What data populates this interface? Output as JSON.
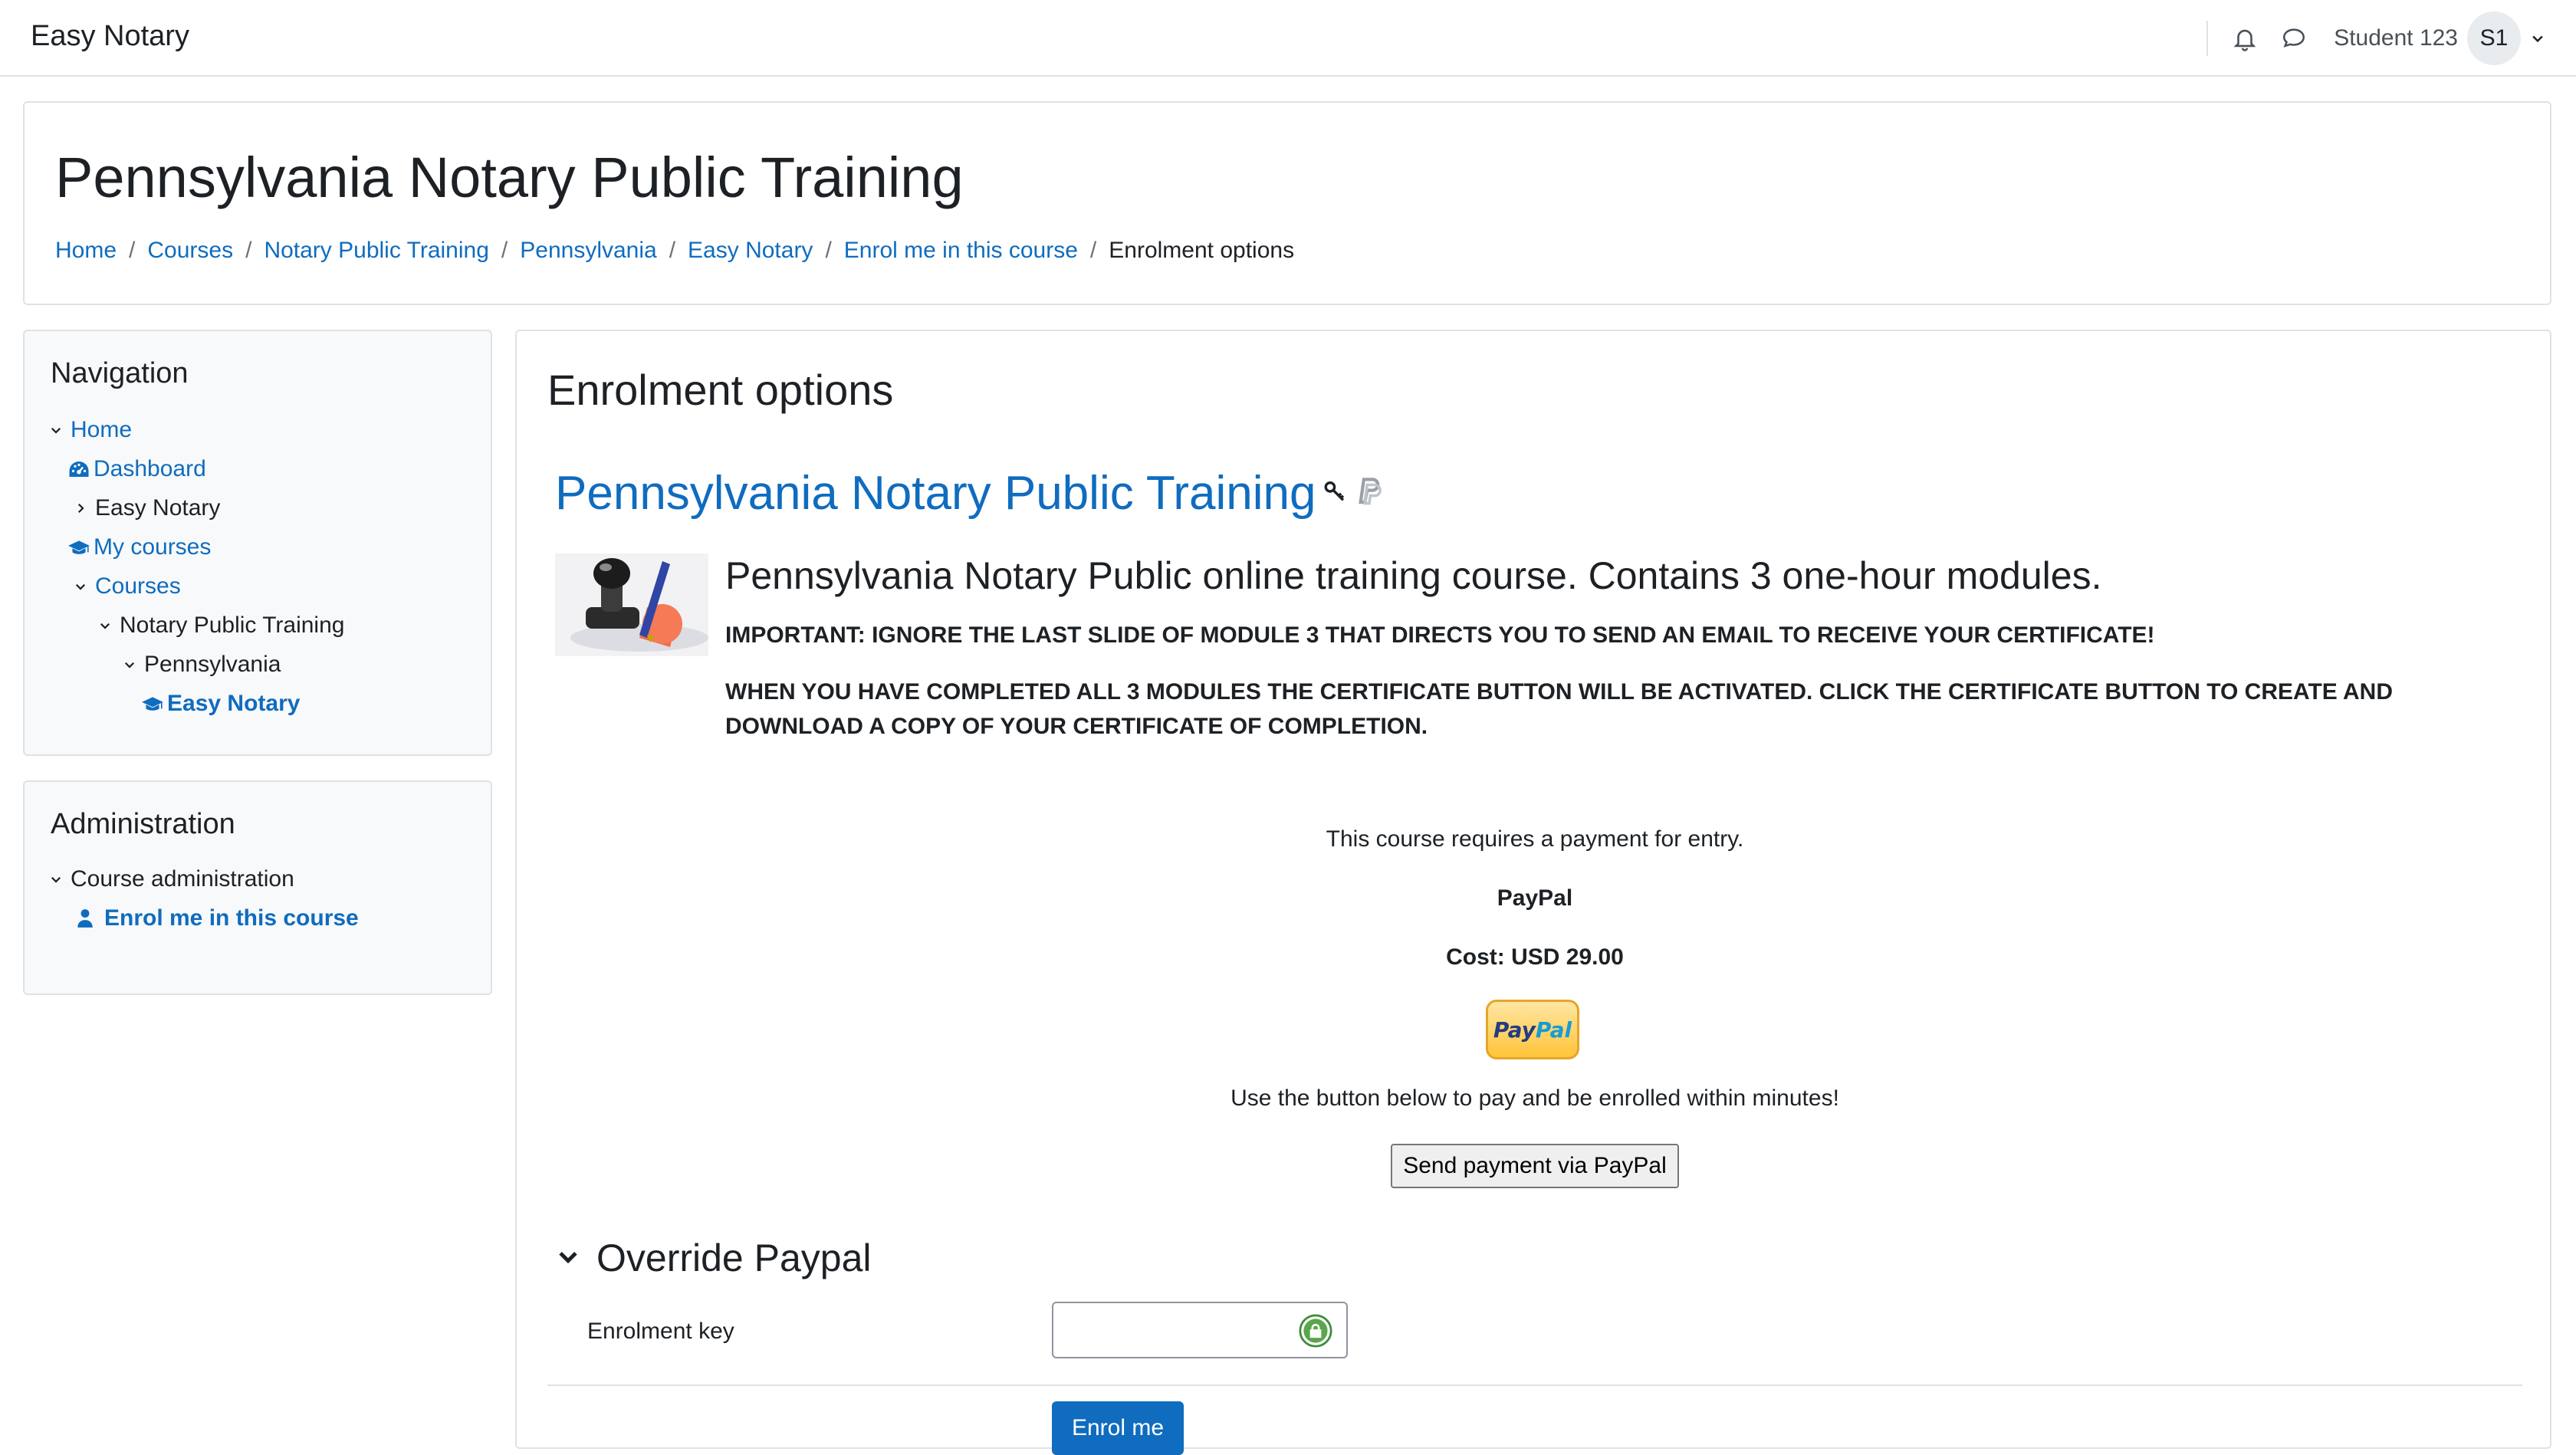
{
  "navbar": {
    "brand": "Easy Notary",
    "user_name": "Student 123",
    "user_initials": "S1",
    "icons": [
      "bell-icon",
      "chat-icon",
      "chevron-down-icon"
    ]
  },
  "header": {
    "title": "Pennsylvania Notary Public Training",
    "breadcrumb": [
      "Home",
      "Courses",
      "Notary Public Training",
      "Pennsylvania",
      "Easy Notary",
      "Enrol me in this course",
      "Enrolment options"
    ]
  },
  "navigation_block": {
    "title": "Navigation",
    "items": [
      {
        "label": "Home",
        "icon": "chevron-down-icon"
      },
      {
        "label": "Dashboard",
        "icon": "dashboard-icon"
      },
      {
        "label": "Easy Notary",
        "icon": "chevron-right-icon"
      },
      {
        "label": "My courses",
        "icon": "graduation-cap-icon"
      },
      {
        "label": "Courses",
        "icon": "chevron-down-icon"
      },
      {
        "label": "Notary Public Training",
        "icon": "chevron-down-icon"
      },
      {
        "label": "Pennsylvania",
        "icon": "chevron-down-icon"
      },
      {
        "label": "Easy Notary",
        "icon": "graduation-cap-icon"
      }
    ]
  },
  "admin_block": {
    "title": "Administration",
    "items": [
      {
        "label": "Course administration",
        "icon": "chevron-down-icon"
      },
      {
        "label": "Enrol me in this course",
        "icon": "user-icon"
      }
    ]
  },
  "main": {
    "heading": "Enrolment options",
    "course_name": "Pennsylvania Notary Public Training",
    "course_icons": [
      "key-icon",
      "paypal-icon"
    ],
    "summary_headline": "Pennsylvania Notary Public online training course. Contains 3 one-hour modules.",
    "summary_important": "IMPORTANT: IGNORE THE LAST SLIDE OF MODULE 3 THAT DIRECTS YOU TO SEND AN EMAIL TO RECEIVE YOUR CERTIFICATE!",
    "summary_certificate": "WHEN YOU HAVE COMPLETED ALL 3 MODULES THE CERTIFICATE BUTTON WILL BE ACTIVATED. CLICK THE CERTIFICATE BUTTON TO CREATE AND DOWNLOAD A COPY OF YOUR CERTIFICATE OF COMPLETION.",
    "payment": {
      "requires_text": "This course requires a payment for entry.",
      "method": "PayPal",
      "cost": "Cost: USD 29.00",
      "logo_text_1": "Pay",
      "logo_text_2": "Pal",
      "instruction": "Use the button below to pay and be enrolled within minutes!",
      "button_label": "Send payment via PayPal"
    },
    "override": {
      "title": "Override Paypal",
      "key_label": "Enrolment key",
      "key_value": "",
      "enrol_button": "Enrol me"
    }
  },
  "colors": {
    "link": "#0f6cbf",
    "primary_button": "#0f6cbf",
    "border": "#dee2e6",
    "block_bg": "#f8f9fa"
  }
}
